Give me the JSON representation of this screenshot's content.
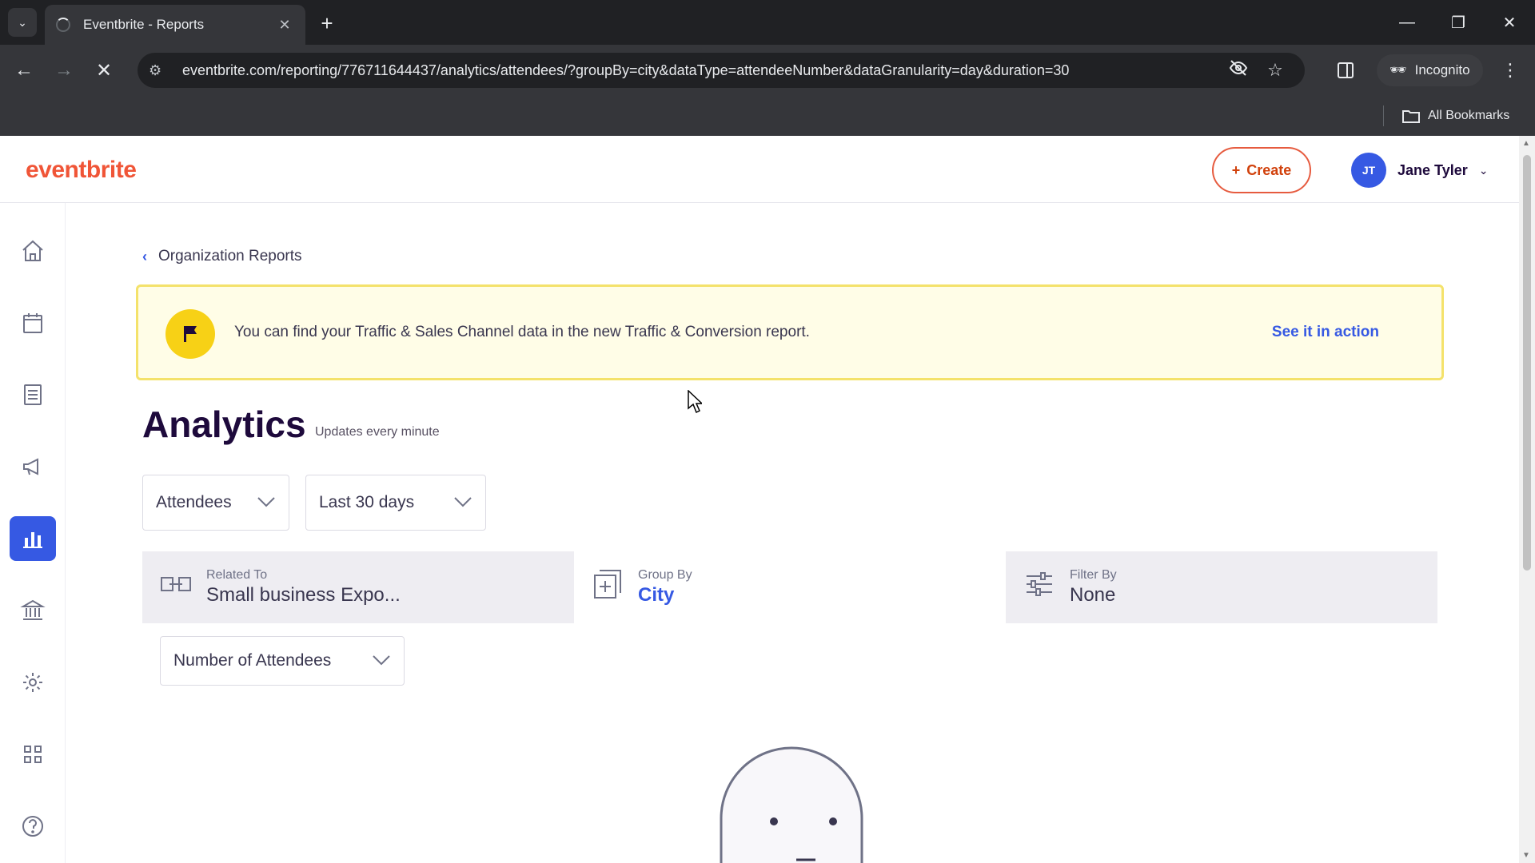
{
  "browser": {
    "tab_title": "Eventbrite - Reports",
    "url": "eventbrite.com/reporting/776711644437/analytics/attendees/?groupBy=city&dataType=attendeeNumber&dataGranularity=day&duration=30",
    "incognito_label": "Incognito",
    "bookmarks_label": "All Bookmarks"
  },
  "header": {
    "logo": "eventbrite",
    "create_label": "Create",
    "user_initials": "JT",
    "user_name": "Jane Tyler"
  },
  "sidebar": {
    "items": [
      {
        "icon": "home-icon"
      },
      {
        "icon": "calendar-icon"
      },
      {
        "icon": "orders-icon"
      },
      {
        "icon": "megaphone-icon"
      },
      {
        "icon": "bar-chart-icon",
        "active": true
      },
      {
        "icon": "bank-icon"
      },
      {
        "icon": "gear-icon"
      },
      {
        "icon": "apps-grid-icon"
      },
      {
        "icon": "help-icon"
      }
    ]
  },
  "main": {
    "breadcrumb": "Organization Reports",
    "banner": {
      "message": "You can find your Traffic & Sales Channel data in the new Traffic & Conversion report.",
      "link": "See it in action"
    },
    "title": "Analytics",
    "subtitle": "Updates every minute",
    "report_type": "Attendees",
    "date_range": "Last 30 days",
    "related_to": {
      "label": "Related To",
      "value": "Small business Expo..."
    },
    "group_by": {
      "label": "Group By",
      "value": "City"
    },
    "filter_by": {
      "label": "Filter By",
      "value": "None"
    },
    "metric": "Number of Attendees"
  },
  "colors": {
    "brand": "#f05537",
    "accent": "#3659e3",
    "banner_bg": "#fffde7",
    "banner_border": "#f4e26b"
  }
}
